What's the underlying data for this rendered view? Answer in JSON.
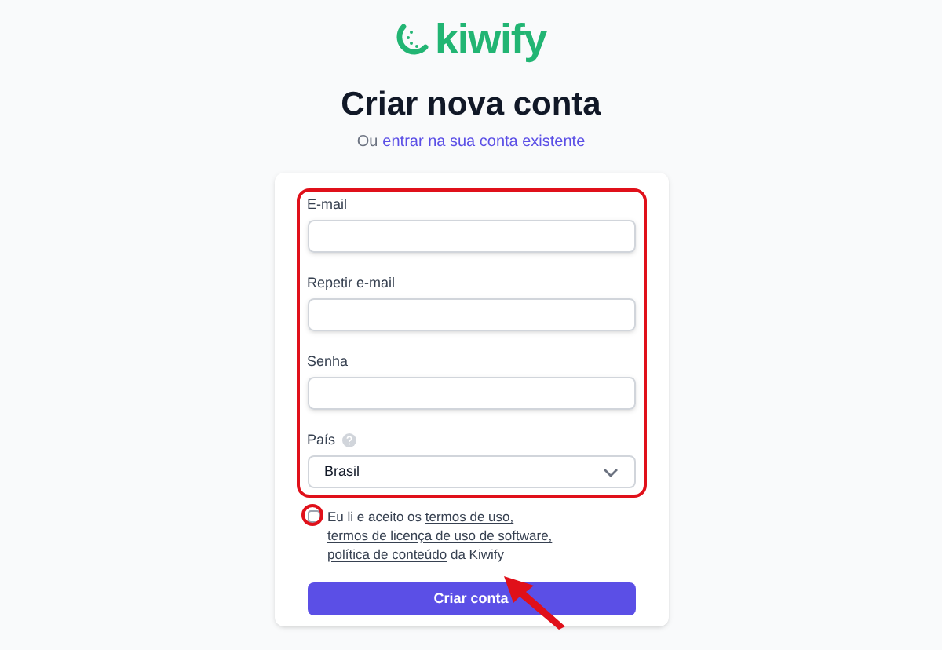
{
  "logo": {
    "text": "kiwify"
  },
  "title": "Criar nova conta",
  "subtitle": {
    "prefix": "Ou",
    "link": "entrar na sua conta existente"
  },
  "fields": [
    {
      "label": "E-mail",
      "kind": "text",
      "help": false
    },
    {
      "label": "Repetir e-mail",
      "kind": "text",
      "help": false
    },
    {
      "label": "Senha",
      "kind": "password",
      "help": false
    },
    {
      "label": "País",
      "kind": "select",
      "value": "Brasil",
      "help": true
    }
  ],
  "terms": {
    "checked": false,
    "parts": [
      {
        "text": "Eu li e aceito os",
        "link": false
      },
      {
        "text": "termos de uso,",
        "link": true
      },
      {
        "text": "termos de licença de uso de software,",
        "link": true
      },
      {
        "text": "política de conteúdo",
        "link": true
      },
      {
        "text": "da Kiwify",
        "link": false
      }
    ]
  },
  "submit_button": "Criar conta",
  "annotations": {
    "highlight_box": true,
    "checkbox_circle": true,
    "arrow": true
  }
}
